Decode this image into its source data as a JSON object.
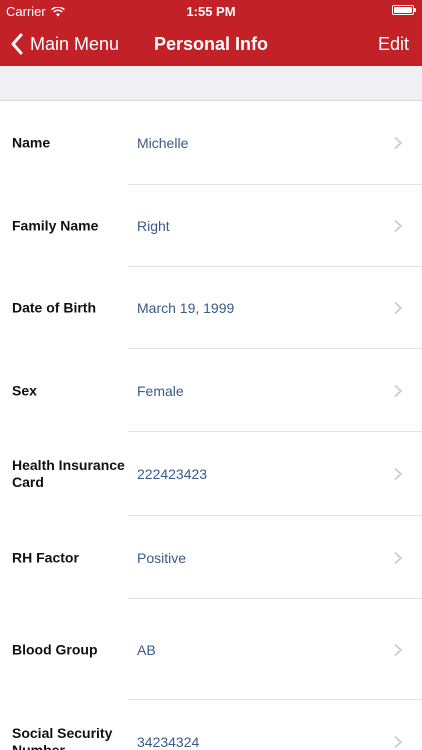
{
  "status_bar": {
    "carrier": "Carrier",
    "time": "1:55 PM",
    "battery_level": 1.0
  },
  "nav": {
    "back_label": "Main Menu",
    "title": "Personal Info",
    "edit_label": "Edit"
  },
  "colors": {
    "header_bg": "#c12127",
    "value_text": "#3a5a8a",
    "section_bg": "#efeff4"
  },
  "rows": [
    {
      "label": "Name",
      "value": "Michelle"
    },
    {
      "label": "Family Name",
      "value": "Right"
    },
    {
      "label": "Date of Birth",
      "value": "March 19, 1999"
    },
    {
      "label": "Sex",
      "value": "Female"
    },
    {
      "label": "Health Insurance Card",
      "value": "222423423"
    },
    {
      "label": "RH Factor",
      "value": "Positive"
    },
    {
      "label": "Blood Group",
      "value": "AB"
    },
    {
      "label": "Social Security Number",
      "value": "34234324"
    }
  ]
}
